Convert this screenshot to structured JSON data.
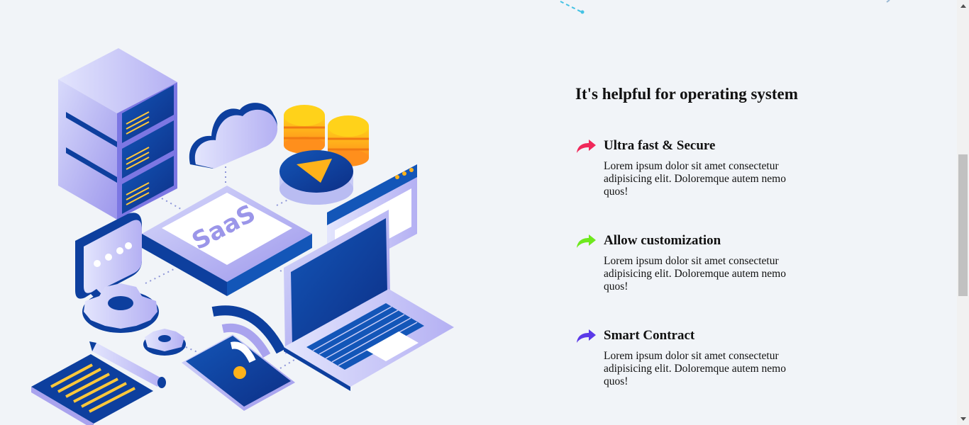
{
  "section": {
    "title": "It's helpful for operating system"
  },
  "features": [
    {
      "title": "Ultra fast & Secure",
      "text": "Lorem ipsum dolor sit amet consectetur adipisicing elit. Doloremque autem nemo quos!",
      "icon": "arrow-icon",
      "color": "#f0285a"
    },
    {
      "title": "Allow customization",
      "text": "Lorem ipsum dolor sit amet consectetur adipisicing elit. Doloremque autem nemo quos!",
      "icon": "arrow-icon",
      "color": "#6ee81e"
    },
    {
      "title": "Smart Contract",
      "text": "Lorem ipsum dolor sit amet consectetur adipisicing elit. Doloremque autem nemo quos!",
      "icon": "arrow-icon",
      "color": "#5b39e8"
    }
  ],
  "illustration": {
    "badge_text": "SaaS"
  },
  "colors": {
    "background": "#f1f4f8",
    "navy": "#0d3f9e",
    "lavender": "#a9a3ee",
    "coin": "#ffb21a",
    "accent_cyan": "#44c2e4"
  }
}
